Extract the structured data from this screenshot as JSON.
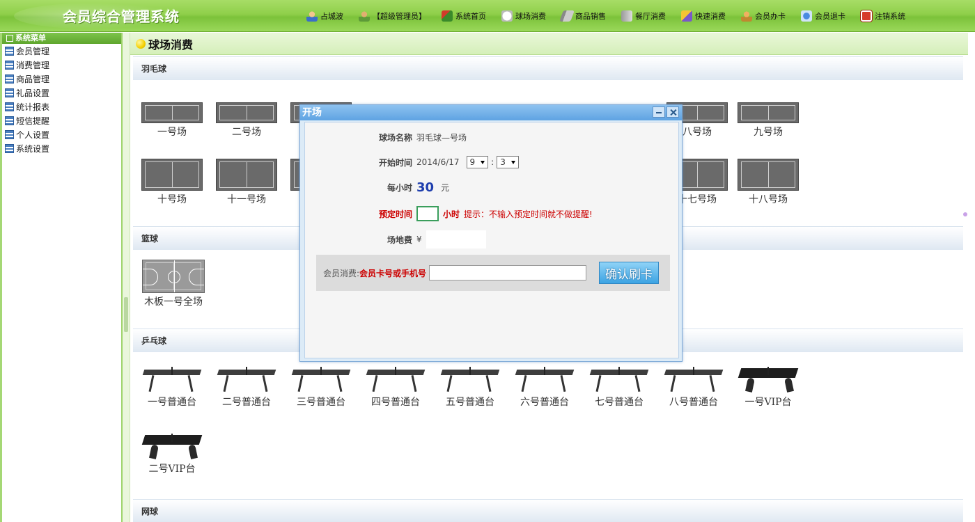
{
  "header": {
    "app_title": "会员综合管理系统",
    "user_name": "占城波",
    "user_role": "【超级管理员】",
    "nav": [
      {
        "label": "系统首页",
        "icon": "home-icon"
      },
      {
        "label": "球场消费",
        "icon": "ball-icon"
      },
      {
        "label": "商品销售",
        "icon": "goods-icon"
      },
      {
        "label": "餐厅消费",
        "icon": "restaurant-icon"
      },
      {
        "label": "快速消费",
        "icon": "quick-icon"
      },
      {
        "label": "会员办卡",
        "icon": "card-icon"
      },
      {
        "label": "会员退卡",
        "icon": "return-icon"
      },
      {
        "label": "注销系统",
        "icon": "logout-icon"
      }
    ]
  },
  "sidebar": {
    "title": "系统菜单",
    "items": [
      {
        "label": "会员管理"
      },
      {
        "label": "消费管理"
      },
      {
        "label": "商品管理"
      },
      {
        "label": "礼品设置"
      },
      {
        "label": "统计报表"
      },
      {
        "label": "短信提醒"
      },
      {
        "label": "个人设置"
      },
      {
        "label": "系统设置"
      }
    ]
  },
  "main": {
    "title": "球场消费",
    "sections": {
      "badminton": {
        "title": "羽毛球",
        "visible_courts": [
          "一号场",
          "二号场",
          "八号场",
          "九号场",
          "十号场",
          "十一号场",
          "十七号场",
          "十八号场"
        ]
      },
      "basketball": {
        "title": "篮球",
        "courts": [
          "木板一号全场"
        ]
      },
      "pingpong": {
        "title": "乒乓球",
        "tables": [
          "一号普通台",
          "二号普通台",
          "三号普通台",
          "四号普通台",
          "五号普通台",
          "六号普通台",
          "七号普通台",
          "八号普通台",
          "一号VIP台",
          "二号VIP台"
        ]
      },
      "tennis": {
        "title": "网球"
      }
    }
  },
  "dialog": {
    "title": "开场",
    "court_name_label": "球场名称",
    "court_name_value": "羽毛球—号场",
    "start_time_label": "开始时间",
    "start_date": "2014/6/17",
    "start_hour": "9",
    "time_sep": ":",
    "start_minute": "3",
    "hourly_label": "每小时",
    "hourly_price": "30",
    "currency_unit": "元",
    "reserve_label": "预定时间",
    "reserve_unit": "小时",
    "reserve_tip": "提示：不输入预定时间就不做提醒!",
    "fee_label": "场地费",
    "fee_symbol": "¥",
    "member_prefix": "会员消费:",
    "member_field_label": "会员卡号或手机号",
    "confirm_label": "确认刷卡"
  }
}
